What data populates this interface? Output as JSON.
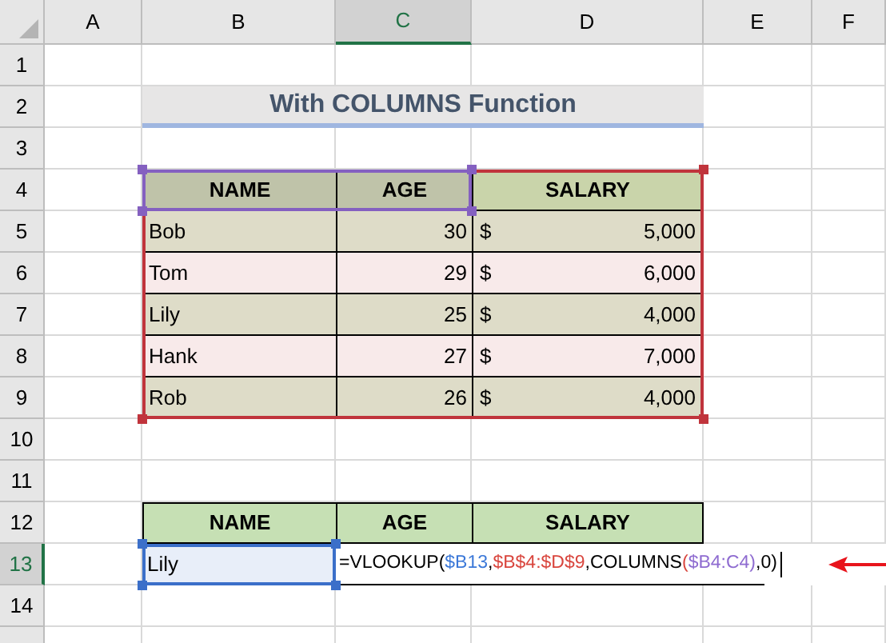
{
  "column_headers": [
    {
      "label": "A",
      "selected": false
    },
    {
      "label": "B",
      "selected": false
    },
    {
      "label": "C",
      "selected": true
    },
    {
      "label": "D",
      "selected": false
    },
    {
      "label": "E",
      "selected": false
    },
    {
      "label": "F",
      "selected": false
    }
  ],
  "row_headers": [
    {
      "label": "1",
      "selected": false
    },
    {
      "label": "2",
      "selected": false
    },
    {
      "label": "3",
      "selected": false
    },
    {
      "label": "4",
      "selected": false
    },
    {
      "label": "5",
      "selected": false
    },
    {
      "label": "6",
      "selected": false
    },
    {
      "label": "7",
      "selected": false
    },
    {
      "label": "8",
      "selected": false
    },
    {
      "label": "9",
      "selected": false
    },
    {
      "label": "10",
      "selected": false
    },
    {
      "label": "11",
      "selected": false
    },
    {
      "label": "12",
      "selected": false
    },
    {
      "label": "13",
      "selected": true
    },
    {
      "label": "14",
      "selected": false
    }
  ],
  "title": "With COLUMNS Function",
  "table": {
    "columns": [
      "NAME",
      "AGE",
      "SALARY"
    ],
    "rows": [
      {
        "name": "Bob",
        "age": "30",
        "currency": "$",
        "salary": "5,000"
      },
      {
        "name": "Tom",
        "age": "29",
        "currency": "$",
        "salary": "6,000"
      },
      {
        "name": "Lily",
        "age": "25",
        "currency": "$",
        "salary": "4,000"
      },
      {
        "name": "Hank",
        "age": "27",
        "currency": "$",
        "salary": "7,000"
      },
      {
        "name": "Rob",
        "age": "26",
        "currency": "$",
        "salary": "4,000"
      }
    ]
  },
  "lookup": {
    "columns": [
      "NAME",
      "AGE",
      "SALARY"
    ],
    "name_value": "Lily",
    "formula": [
      {
        "text": "=VLOOKUP(",
        "color": "#000000"
      },
      {
        "text": "$B13",
        "color": "#3b78d8"
      },
      {
        "text": ",",
        "color": "#000000"
      },
      {
        "text": "$B$4:$D$9",
        "color": "#d9453d"
      },
      {
        "text": ",COLUMNS",
        "color": "#000000"
      },
      {
        "text": "(",
        "color": "#d9453d"
      },
      {
        "text": "$B4:C4",
        "color": "#8e6bd0"
      },
      {
        "text": ")",
        "color": "#8e6bd0"
      },
      {
        "text": ",0)",
        "color": "#000000"
      }
    ]
  }
}
